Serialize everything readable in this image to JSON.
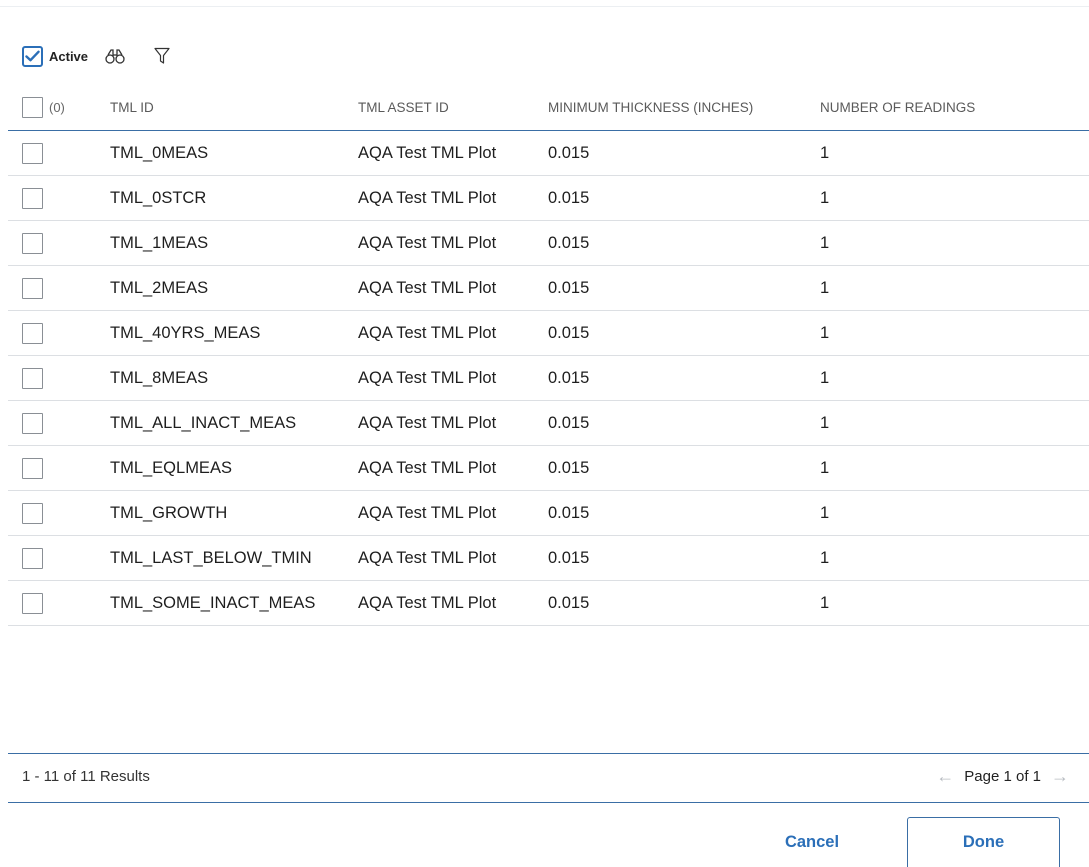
{
  "toolbar": {
    "active_label": "Active",
    "active_checked": true,
    "search_icon": "binoculars-icon",
    "filter_icon": "funnel-icon"
  },
  "grid": {
    "selected_count": "(0)",
    "columns": [
      "TML ID",
      "TML ASSET ID",
      "MINIMUM THICKNESS (INCHES)",
      "NUMBER OF READINGS"
    ],
    "rows": [
      {
        "id": "TML_0MEAS",
        "asset": "AQA Test TML Plot",
        "min": "0.015",
        "num": "1"
      },
      {
        "id": "TML_0STCR",
        "asset": "AQA Test TML Plot",
        "min": "0.015",
        "num": "1"
      },
      {
        "id": "TML_1MEAS",
        "asset": "AQA Test TML Plot",
        "min": "0.015",
        "num": "1"
      },
      {
        "id": "TML_2MEAS",
        "asset": "AQA Test TML Plot",
        "min": "0.015",
        "num": "1"
      },
      {
        "id": "TML_40YRS_MEAS",
        "asset": "AQA Test TML Plot",
        "min": "0.015",
        "num": "1"
      },
      {
        "id": "TML_8MEAS",
        "asset": "AQA Test TML Plot",
        "min": "0.015",
        "num": "1"
      },
      {
        "id": "TML_ALL_INACT_MEAS",
        "asset": "AQA Test TML Plot",
        "min": "0.015",
        "num": "1"
      },
      {
        "id": "TML_EQLMEAS",
        "asset": "AQA Test TML Plot",
        "min": "0.015",
        "num": "1"
      },
      {
        "id": "TML_GROWTH",
        "asset": "AQA Test TML Plot",
        "min": "0.015",
        "num": "1"
      },
      {
        "id": "TML_LAST_BELOW_TMIN",
        "asset": "AQA Test TML Plot",
        "min": "0.015",
        "num": "1"
      },
      {
        "id": "TML_SOME_INACT_MEAS",
        "asset": "AQA Test TML Plot",
        "min": "0.015",
        "num": "1"
      }
    ]
  },
  "footer": {
    "results_text": "1 - 11 of 11 Results",
    "page_text": "Page 1 of 1",
    "prev_icon": "arrow-left-icon",
    "next_icon": "arrow-right-icon"
  },
  "buttons": {
    "cancel_label": "Cancel",
    "done_label": "Done"
  },
  "colors": {
    "accent": "#2b6fb8",
    "header_rule": "#3a6ea5",
    "row_border": "#dcdfe3"
  }
}
